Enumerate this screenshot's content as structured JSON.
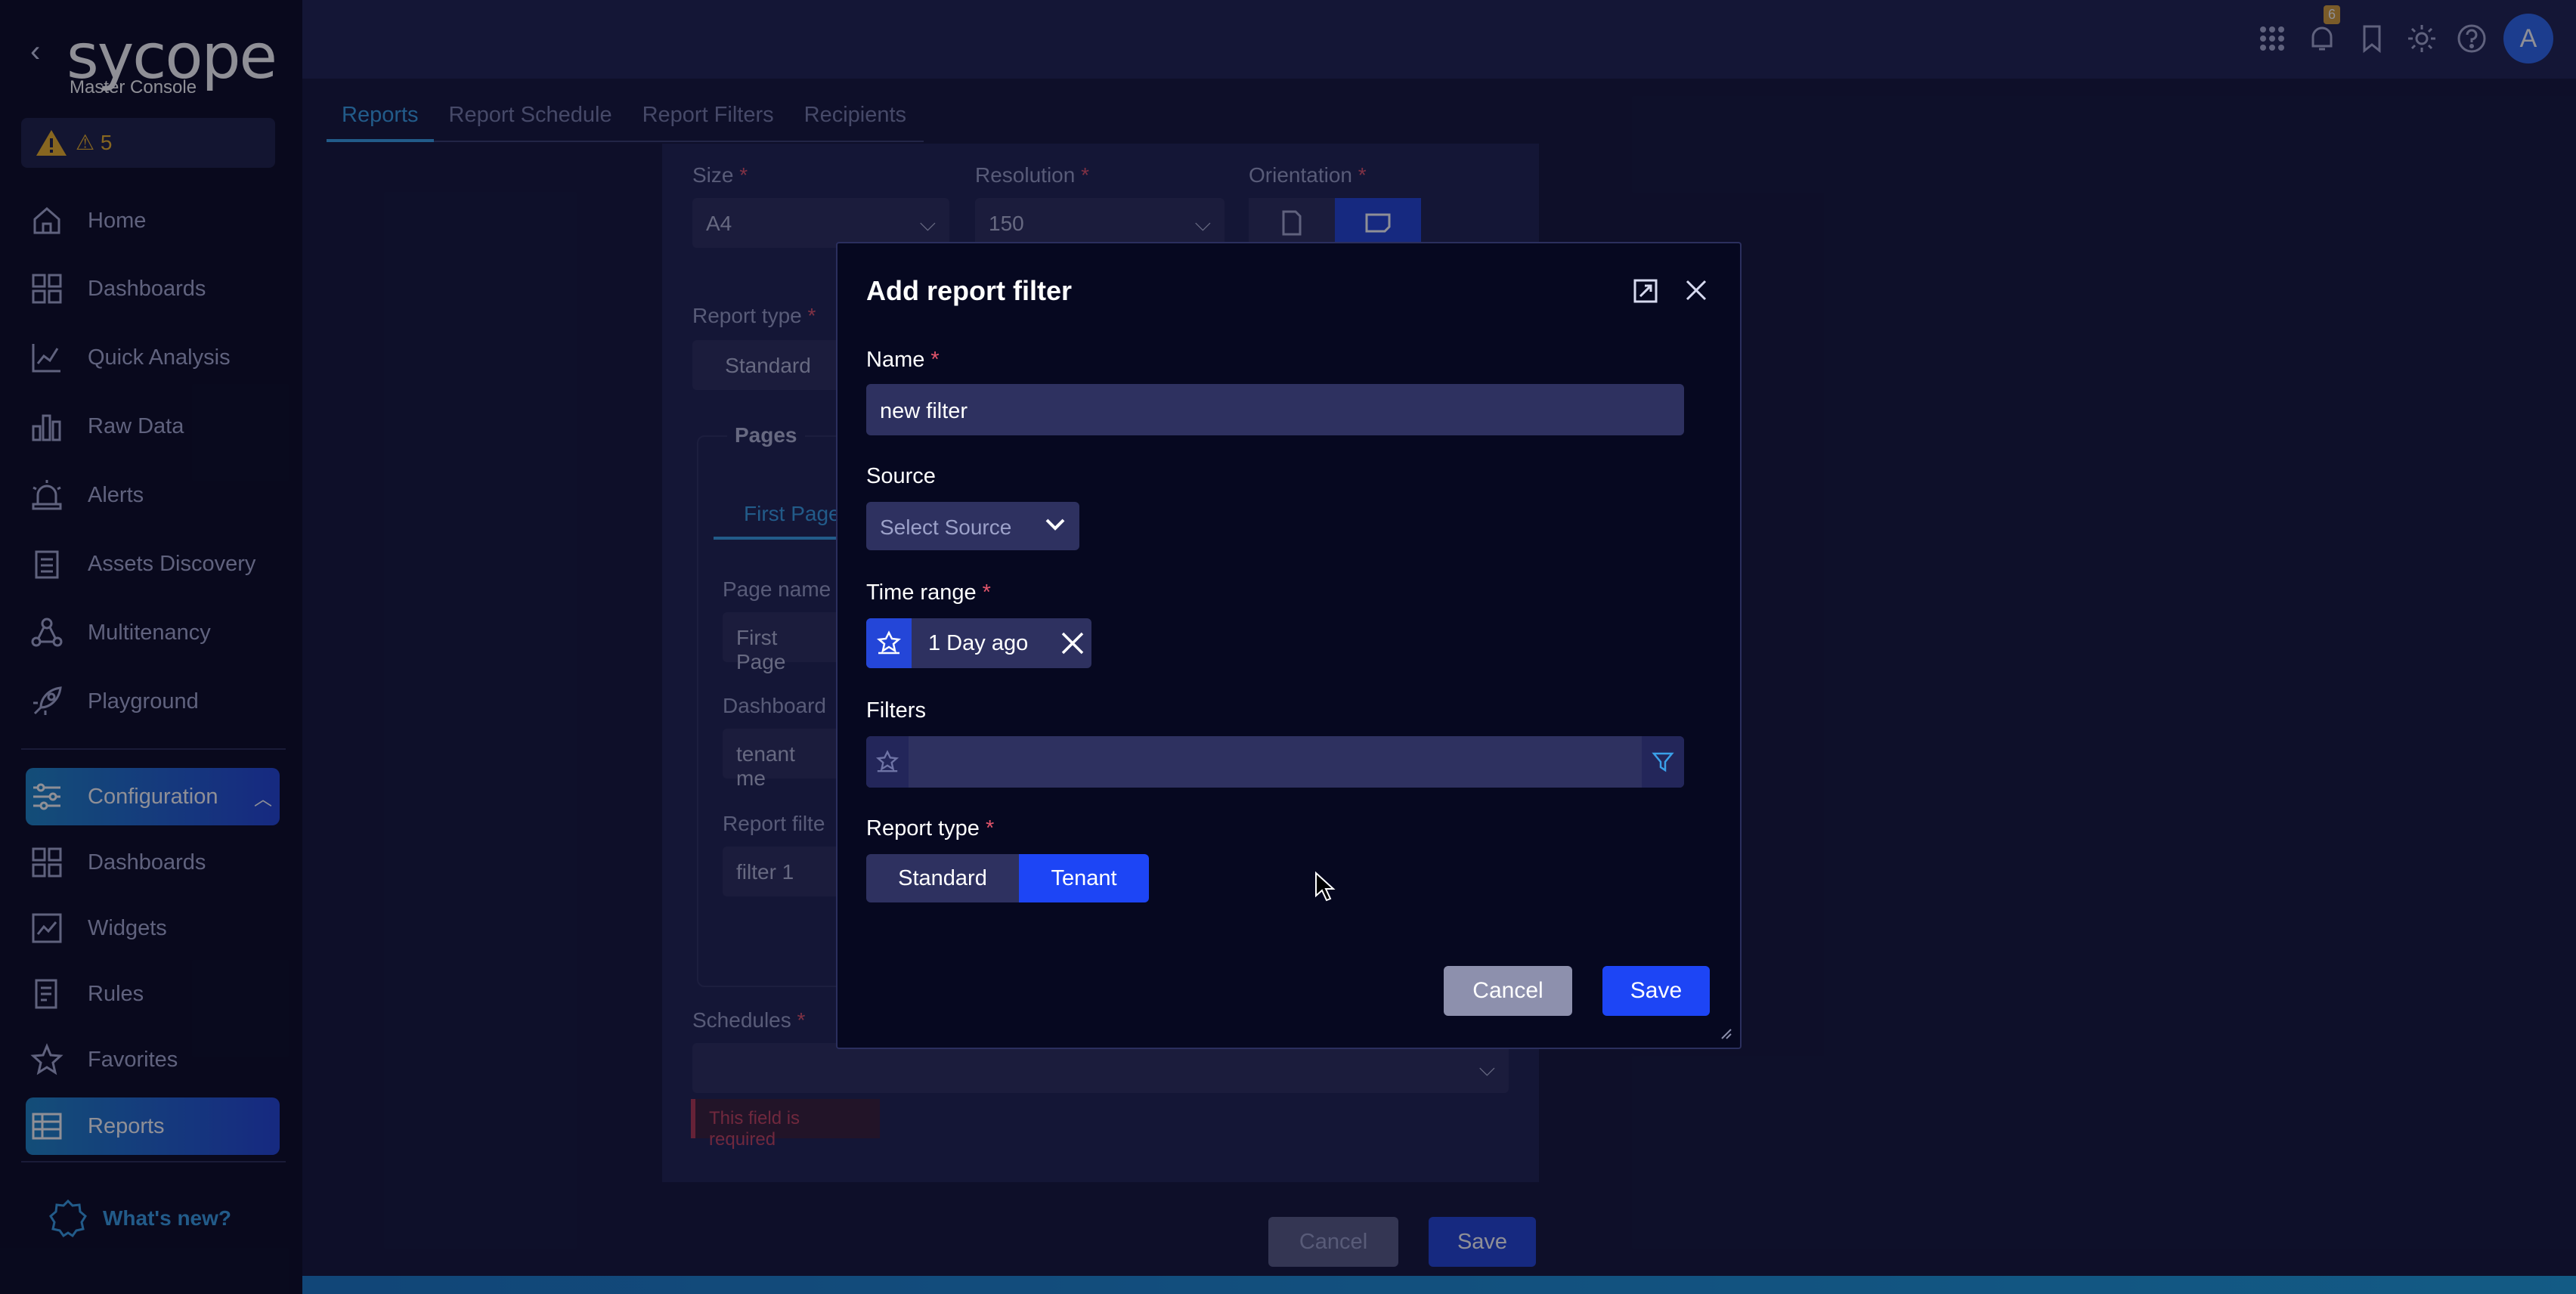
{
  "app": {
    "logo_text": "sycope",
    "logo_subtitle": "Master Console",
    "alerts_count": "5"
  },
  "sidebar": {
    "items": [
      {
        "label": "Home",
        "icon": "home-icon"
      },
      {
        "label": "Dashboards",
        "icon": "grid-icon"
      },
      {
        "label": "Quick Analysis",
        "icon": "analysis-icon"
      },
      {
        "label": "Raw Data",
        "icon": "bar-chart-icon"
      },
      {
        "label": "Alerts",
        "icon": "siren-icon"
      },
      {
        "label": "Assets Discovery",
        "icon": "clipboard-icon"
      },
      {
        "label": "Multitenancy",
        "icon": "network-icon"
      },
      {
        "label": "Playground",
        "icon": "rocket-icon"
      }
    ],
    "config_label": "Configuration",
    "config_items": [
      {
        "label": "Dashboards",
        "icon": "grid-icon"
      },
      {
        "label": "Widgets",
        "icon": "widget-icon"
      },
      {
        "label": "Rules",
        "icon": "rules-icon"
      },
      {
        "label": "Favorites",
        "icon": "star-icon"
      },
      {
        "label": "Reports",
        "icon": "table-icon"
      }
    ],
    "whats_new": "What's new?"
  },
  "topbar": {
    "notification_badge": "6",
    "avatar_letter": "A"
  },
  "tabs": [
    "Reports",
    "Report Schedule",
    "Report Filters",
    "Recipients"
  ],
  "form": {
    "size_label": "Size",
    "size_value": "A4",
    "resolution_label": "Resolution",
    "resolution_value": "150",
    "orientation_label": "Orientation",
    "report_type_label": "Report type",
    "report_type_value": "Standard",
    "pages_label": "Pages",
    "first_page_tab": "First Page",
    "page_name_label": "Page name",
    "page_name_value": "First Page",
    "dashboard_label": "Dashboard",
    "dashboard_value": "tenant me",
    "report_filter_label": "Report filte",
    "report_filter_value": "filter 1",
    "schedules_label": "Schedules",
    "error_text": "This field is required",
    "cancel": "Cancel",
    "save": "Save"
  },
  "modal": {
    "title": "Add report filter",
    "name_label": "Name",
    "name_value": "new filter",
    "source_label": "Source",
    "source_placeholder": "Select Source",
    "time_range_label": "Time range",
    "time_range_value": "1 Day ago",
    "filters_label": "Filters",
    "report_type_label": "Report type",
    "report_type_options": [
      "Standard",
      "Tenant"
    ],
    "report_type_selected": "Tenant",
    "cancel": "Cancel",
    "save": "Save"
  },
  "colors": {
    "accent": "#2446d8",
    "link": "#3aa0e8",
    "required": "#e2556b",
    "warning": "#f0b429"
  }
}
